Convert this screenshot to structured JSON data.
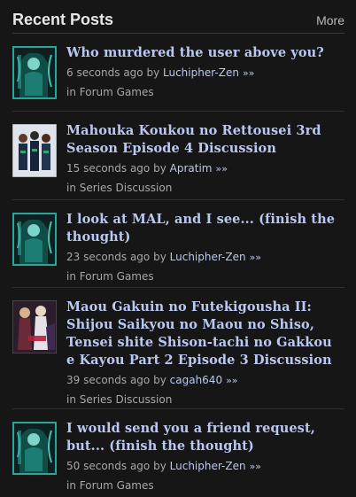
{
  "header": {
    "title": "Recent Posts",
    "more_label": "More"
  },
  "posts": [
    {
      "title": "Who murdered the user above you?",
      "time": "6 seconds ago",
      "by": "by",
      "user": "Luchipher-Zen",
      "chevron": "»»",
      "in": "in",
      "category": "Forum Games",
      "thumb": "teal-character-avatar"
    },
    {
      "title": "Mahouka Koukou no Rettousei 3rd Season Episode 4 Discussion",
      "time": "15 seconds ago",
      "by": "by",
      "user": "Apratim",
      "chevron": "»»",
      "in": "in",
      "category": "Series Discussion",
      "thumb": "anime-group-cover"
    },
    {
      "title": "I look at MAL, and I see... (finish the thought)",
      "time": "23 seconds ago",
      "by": "by",
      "user": "Luchipher-Zen",
      "chevron": "»»",
      "in": "in",
      "category": "Forum Games",
      "thumb": "teal-character-avatar"
    },
    {
      "title": "Maou Gakuin no Futekigousha II: Shijou Saikyou no Maou no Shiso, Tensei shite Shison-tachi no Gakkou e Kayou Part 2 Episode 3 Discussion",
      "time": "39 seconds ago",
      "by": "by",
      "user": "cagah640",
      "chevron": "»»",
      "in": "in",
      "category": "Series Discussion",
      "thumb": "anime-poster-cover"
    },
    {
      "title": "I would send you a friend request, but... (finish the thought)",
      "time": "50 seconds ago",
      "by": "by",
      "user": "Luchipher-Zen",
      "chevron": "»»",
      "in": "in",
      "category": "Forum Games",
      "thumb": "teal-character-avatar"
    }
  ],
  "colors": {
    "background": "#161616",
    "link": "#b9c8f0",
    "meta": "#a7a7a7",
    "title": "#e6e6e6"
  }
}
